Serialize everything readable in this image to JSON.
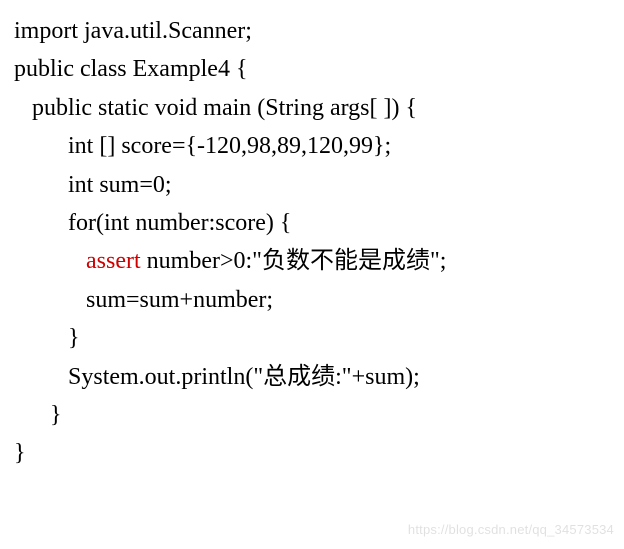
{
  "code": {
    "lines": [
      {
        "indent": 0,
        "segments": [
          {
            "text": "import java.util.Scanner;"
          }
        ]
      },
      {
        "indent": 0,
        "segments": [
          {
            "text": "public class Example4 {"
          }
        ]
      },
      {
        "indent": 1,
        "segments": [
          {
            "text": "public static void main (String args[ ]) {"
          }
        ]
      },
      {
        "indent": 3,
        "segments": [
          {
            "text": "int [] score={-120,98,89,120,99};"
          }
        ]
      },
      {
        "indent": 3,
        "segments": [
          {
            "text": "int sum=0;"
          }
        ]
      },
      {
        "indent": 3,
        "segments": [
          {
            "text": "for(int number:score) {"
          }
        ]
      },
      {
        "indent": 4,
        "segments": [
          {
            "text": "assert",
            "style": "keyword-red"
          },
          {
            "text": " number>0:\"负数不能是成绩\";"
          }
        ]
      },
      {
        "indent": 4,
        "segments": [
          {
            "text": "sum=sum+number;"
          }
        ]
      },
      {
        "indent": 3,
        "segments": [
          {
            "text": "}"
          }
        ]
      },
      {
        "indent": 3,
        "segments": [
          {
            "text": "System.out.println(\"总成绩:\"+sum);"
          }
        ]
      },
      {
        "indent": 2,
        "segments": [
          {
            "text": "}"
          }
        ]
      },
      {
        "indent": 0,
        "segments": [
          {
            "text": "}"
          }
        ]
      }
    ]
  },
  "watermark": "https://blog.csdn.net/qq_34573534"
}
